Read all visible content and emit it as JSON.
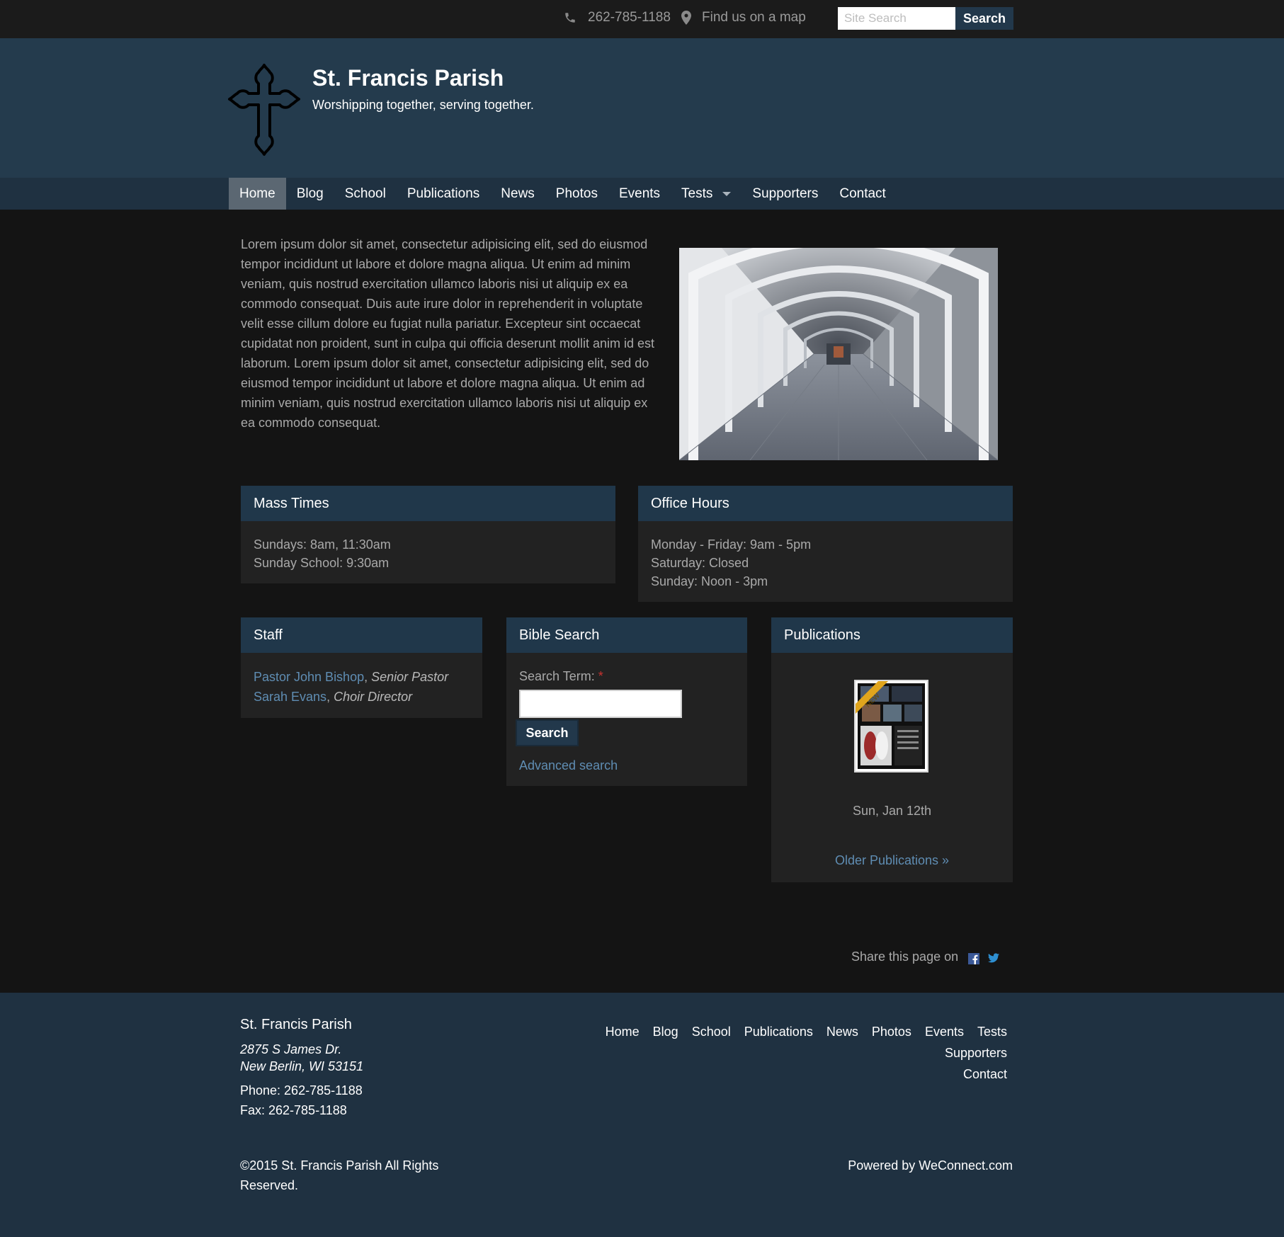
{
  "topbar": {
    "phone": "262-785-1188",
    "map_link": "Find us on a map",
    "search_placeholder": "Site Search",
    "search_button": "Search"
  },
  "header": {
    "title": "St. Francis Parish",
    "tagline": "Worshipping together, serving together."
  },
  "nav": {
    "items": [
      "Home",
      "Blog",
      "School",
      "Publications",
      "News",
      "Photos",
      "Events",
      "Tests",
      "Supporters",
      "Contact"
    ],
    "active": "Home"
  },
  "intro": {
    "text": "Lorem ipsum dolor sit amet, consectetur adipisicing elit, sed do eiusmod tempor incididunt ut labore et dolore magna aliqua. Ut enim ad minim veniam, quis nostrud exercitation ullamco laboris nisi ut aliquip ex ea commodo consequat. Duis aute irure dolor in reprehenderit in voluptate velit esse cillum dolore eu fugiat nulla pariatur. Excepteur sint occaecat cupidatat non proident, sunt in culpa qui officia deserunt mollit anim id est laborum. Lorem ipsum dolor sit amet, consectetur adipisicing elit, sed do eiusmod tempor incididunt ut labore et dolore magna aliqua. Ut enim ad minim veniam, quis nostrud exercitation ullamco laboris nisi ut aliquip ex ea commodo consequat."
  },
  "mass_times": {
    "title": "Mass Times",
    "lines": [
      "Sundays: 8am, 11:30am",
      "Sunday School: 9:30am"
    ]
  },
  "office_hours": {
    "title": "Office Hours",
    "lines": [
      "Monday - Friday: 9am - 5pm",
      "Saturday: Closed",
      "Sunday: Noon - 3pm"
    ]
  },
  "staff": {
    "title": "Staff",
    "members": [
      {
        "name": "Pastor John Bishop",
        "role": "Senior Pastor"
      },
      {
        "name": "Sarah Evans",
        "role": "Choir Director"
      }
    ]
  },
  "bible_search": {
    "title": "Bible Search",
    "label": "Search Term:",
    "required_mark": "*",
    "button": "Search",
    "advanced_link": "Advanced search"
  },
  "publications": {
    "title": "Publications",
    "badge": "NEW",
    "date": "Sun, Jan 12th",
    "older_link": "Older Publications »"
  },
  "share": {
    "text": "Share this page on"
  },
  "footer": {
    "name": "St. Francis Parish",
    "address_line1": "2875 S James Dr.",
    "address_line2": "New Berlin, WI 53151",
    "phone": "Phone: 262-785-1188",
    "fax": "Fax: 262-785-1188",
    "nav": [
      "Home",
      "Blog",
      "School",
      "Publications",
      "News",
      "Photos",
      "Events",
      "Tests",
      "Supporters",
      "Contact"
    ],
    "copyright": "©2015 St. Francis Parish All Rights Reserved.",
    "powered_by": "Powered by WeConnect.com"
  },
  "colors": {
    "page_bg": "#141414",
    "header_bg": "#243b4d",
    "nav_bg": "#1f3141",
    "panel_head": "#20374a",
    "panel_body": "#222222",
    "link": "#5f8db3"
  },
  "icons": [
    "phone-icon",
    "map-marker-icon",
    "cross-logo-icon",
    "facebook-icon",
    "twitter-icon",
    "dropdown-caret-icon"
  ]
}
